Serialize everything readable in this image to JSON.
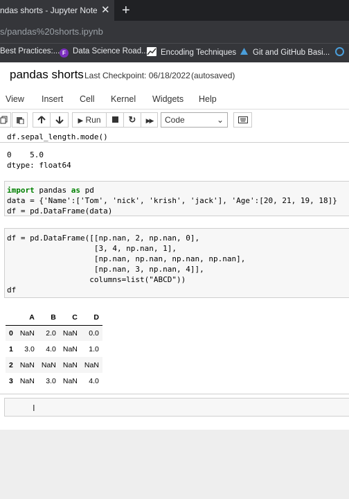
{
  "browser": {
    "tab_title": "ndas shorts - Jupyter Noteboo",
    "tab_close": "✕",
    "new_tab": "+",
    "url": "s/pandas%20shorts.ipynb",
    "bookmarks": [
      {
        "label": "Best Practices:...",
        "icon": "bookmark-icon"
      },
      {
        "label": "Data Science Road...",
        "icon": "f-logo-icon",
        "icon_letter": "F",
        "color": "#7b2fbe"
      },
      {
        "label": "Encoding Techniques",
        "icon": "chart-icon"
      },
      {
        "label": "Git and GitHub Basi...",
        "icon": "git-icon"
      }
    ]
  },
  "notebook": {
    "name": "pandas shorts",
    "checkpoint": "Last Checkpoint: 06/18/2022",
    "autosave": "(autosaved)"
  },
  "menu": [
    "View",
    "Insert",
    "Cell",
    "Kernel",
    "Widgets",
    "Help"
  ],
  "toolbar": {
    "run_label": "Run",
    "cell_type": "Code",
    "icons": [
      "copy-icon",
      "paste-icon",
      "move-up-icon",
      "move-down-icon",
      "run-icon",
      "stop-icon",
      "restart-icon",
      "fast-forward-icon",
      "keyboard-icon"
    ]
  },
  "cells": {
    "c1_code": "df.sepal_length.mode()",
    "c1_output": "0    5.0\ndtype: float64",
    "c2_line1_kw1": "import",
    "c2_line1_mid": " pandas ",
    "c2_line1_kw2": "as",
    "c2_line1_end": " pd",
    "c2_line2": "data = {'Name':['Tom', 'nick', 'krish', 'jack'], 'Age':[20, 21, 19, 18]}",
    "c2_line3": "df = pd.DataFrame(data)",
    "c3_code": "df = pd.DataFrame([[np.nan, 2, np.nan, 0],\n                   [3, 4, np.nan, 1],\n                   [np.nan, np.nan, np.nan, np.nan],\n                   [np.nan, 3, np.nan, 4]],\n                  columns=list(\"ABCD\"))\ndf"
  },
  "dataframe": {
    "columns": [
      "",
      "A",
      "B",
      "C",
      "D"
    ],
    "rows": [
      [
        "0",
        "NaN",
        "2.0",
        "NaN",
        "0.0"
      ],
      [
        "1",
        "3.0",
        "4.0",
        "NaN",
        "1.0"
      ],
      [
        "2",
        "NaN",
        "NaN",
        "NaN",
        "NaN"
      ],
      [
        "3",
        "NaN",
        "3.0",
        "NaN",
        "4.0"
      ]
    ]
  },
  "cursor": "I"
}
